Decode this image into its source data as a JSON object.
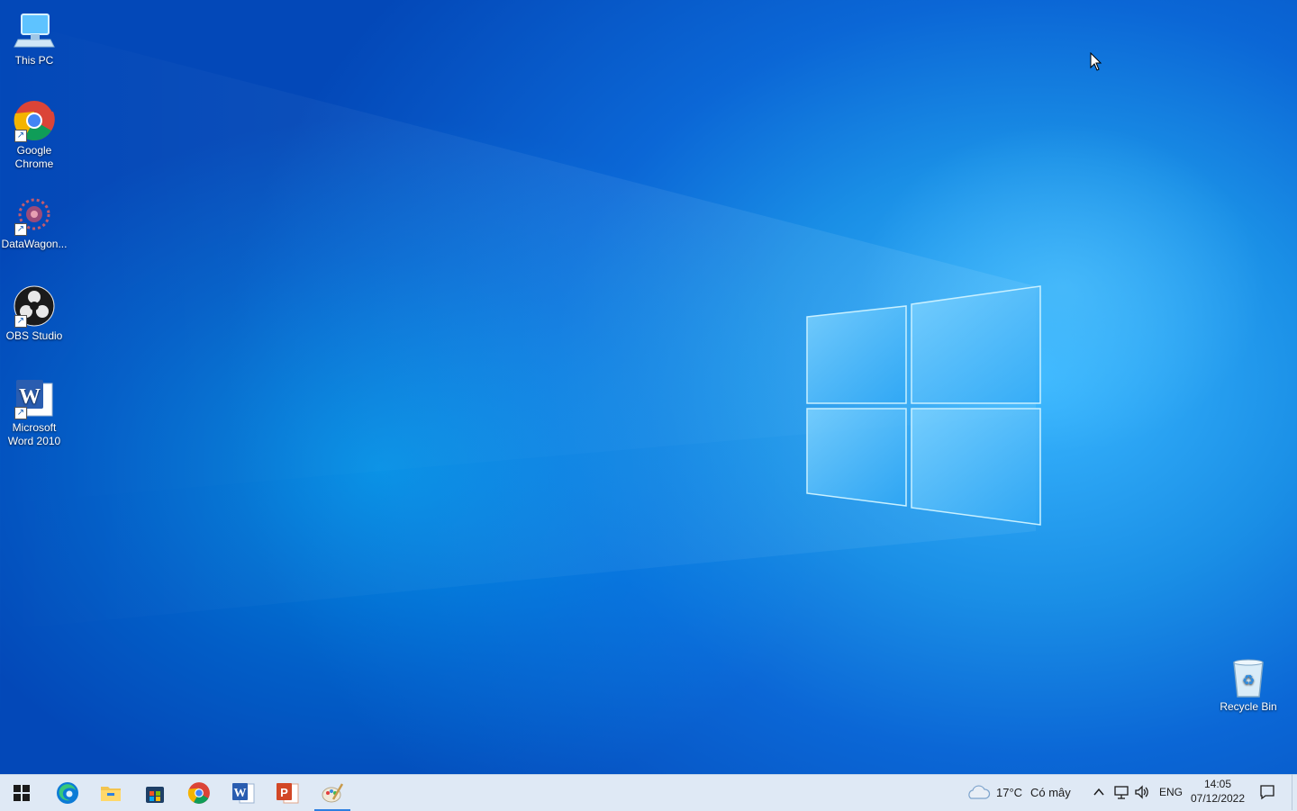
{
  "desktop": {
    "icons": [
      {
        "label": "This PC",
        "icon": "computer-icon"
      },
      {
        "label": "Google Chrome",
        "icon": "chrome-icon"
      },
      {
        "label": "DataWagon...",
        "icon": "datawagon-icon"
      },
      {
        "label": "OBS Studio",
        "icon": "obs-icon"
      },
      {
        "label": "Microsoft Word 2010",
        "icon": "word-icon"
      },
      {
        "label": "Recycle Bin",
        "icon": "recycle-bin-icon"
      }
    ]
  },
  "taskbar": {
    "apps": [
      {
        "name": "start",
        "icon": "windows-start-icon"
      },
      {
        "name": "edge",
        "icon": "edge-icon"
      },
      {
        "name": "file-explorer",
        "icon": "folder-icon"
      },
      {
        "name": "store",
        "icon": "store-icon"
      },
      {
        "name": "chrome",
        "icon": "chrome-icon"
      },
      {
        "name": "word",
        "icon": "word-icon"
      },
      {
        "name": "powerpoint",
        "icon": "powerpoint-icon"
      },
      {
        "name": "paint",
        "icon": "paint-icon",
        "active": true
      }
    ],
    "weather": {
      "temp": "17°C",
      "condition": "Có mây",
      "icon": "cloud-icon"
    },
    "tray": {
      "language": "ENG"
    },
    "clock": {
      "time": "14:05",
      "date": "07/12/2022"
    }
  },
  "colors": {
    "accent": "#2d7fe0",
    "taskbar_bg": "#dfe9f5",
    "wallpaper": "#0b67d6"
  }
}
